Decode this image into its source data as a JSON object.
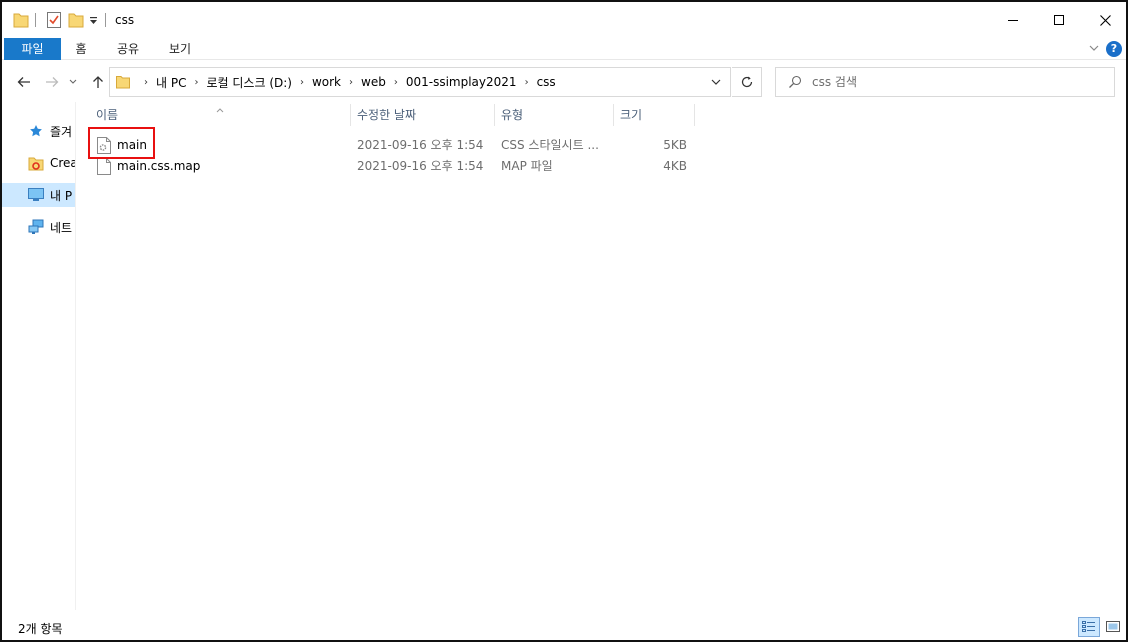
{
  "window": {
    "title": "css"
  },
  "ribbon": {
    "tabs": [
      "파일",
      "홈",
      "공유",
      "보기"
    ],
    "help_symbol": "?"
  },
  "breadcrumb": {
    "items": [
      "내 PC",
      "로컬 디스크 (D:)",
      "work",
      "web",
      "001-ssimplay2021",
      "css"
    ],
    "separator": "›"
  },
  "search": {
    "placeholder": "css 검색"
  },
  "navpane": {
    "items": [
      {
        "label": "즐겨",
        "icon": "star-icon"
      },
      {
        "label": "Creat",
        "icon": "creative-cloud-icon"
      },
      {
        "label": "내 P",
        "icon": "pc-icon",
        "selected": true
      },
      {
        "label": "네트",
        "icon": "network-icon"
      }
    ]
  },
  "columns": [
    "이름",
    "수정한 날짜",
    "유형",
    "크기"
  ],
  "files": [
    {
      "name": "main",
      "modified": "2021-09-16 오후 1:54",
      "type": "CSS 스타일시트 ...",
      "size": "5KB",
      "icon": "css-file-icon"
    },
    {
      "name": "main.css.map",
      "modified": "2021-09-16 오후 1:54",
      "type": "MAP 파일",
      "size": "4KB",
      "icon": "generic-file-icon"
    }
  ],
  "status": {
    "item_count": "2개 항목"
  },
  "colors": {
    "file_tab": "#1979ca",
    "selection": "#cce8ff",
    "highlight": "#e81010",
    "folder": "#f8d775"
  }
}
